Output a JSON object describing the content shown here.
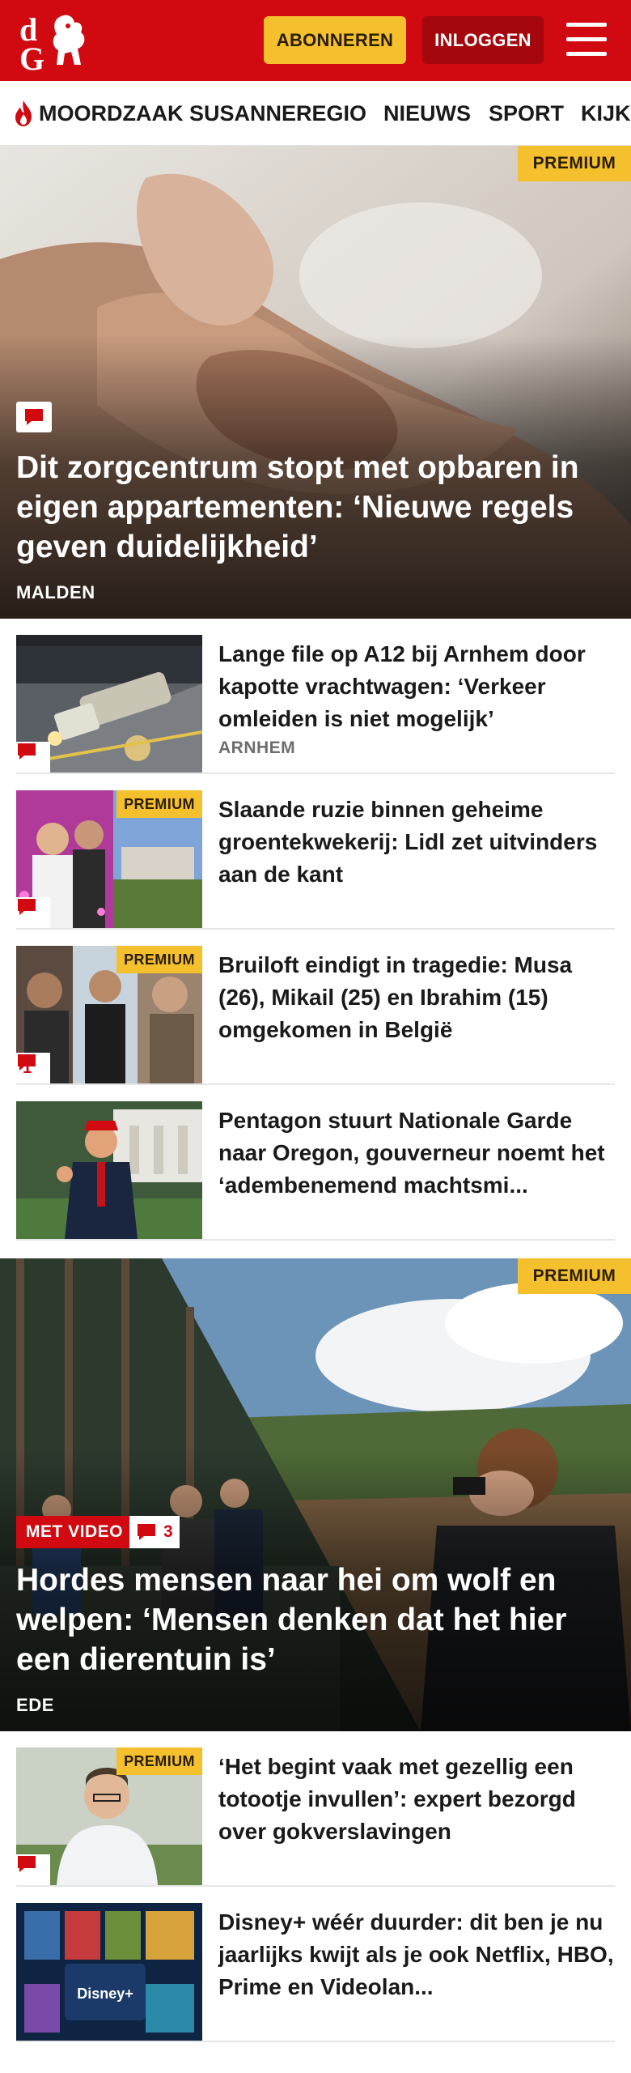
{
  "header": {
    "logo_text": "dG",
    "subscribe_label": "ABONNEREN",
    "login_label": "INLOGGEN",
    "colors": {
      "brand_red": "#d10a11",
      "premium_yellow": "#f5c02e"
    }
  },
  "nav": {
    "items": [
      {
        "label": "MOORDZAAK SUSANNE",
        "icon": "flame-icon"
      },
      {
        "label": "REGIO"
      },
      {
        "label": "NIEUWS"
      },
      {
        "label": "SPORT"
      },
      {
        "label": "KIJK"
      }
    ]
  },
  "hero1": {
    "premium": "PREMIUM",
    "title": "Dit zorgcentrum stopt met opbaren in eigen appartementen: ‘Nieuwe regels geven duidelijkheid’",
    "location": "MALDEN",
    "icon": "comment-icon"
  },
  "articles1": [
    {
      "title": "Lange file op A12 bij Arnhem door kapotte vrachtwagen: ‘Verkeer omleiden is niet mogelijk’",
      "location": "ARNHEM",
      "premium": "",
      "comments": ""
    },
    {
      "title": "Slaande ruzie binnen geheime groentekwekerij: Lidl zet uitvinders aan de kant",
      "location": "",
      "premium": "PREMIUM",
      "comments": ""
    },
    {
      "title": "Bruiloft eindigt in tragedie: Musa (26), Mikail (25) en Ibrahim (15) omgekomen in België",
      "location": "",
      "premium": "PREMIUM",
      "comments": "1"
    },
    {
      "title": "Pentagon stuurt Nationale Garde naar Oregon, gouverneur noemt het ‘adembenemend machtsmi...",
      "location": "",
      "premium": "",
      "comments": ""
    }
  ],
  "hero2": {
    "premium": "PREMIUM",
    "video_label": "MET VIDEO",
    "comments": "3",
    "title": "Hordes mensen naar hei om wolf en welpen: ‘Mensen denken dat het hier een dierentuin is’",
    "location": "EDE"
  },
  "articles2": [
    {
      "title": "‘Het begint vaak met gezellig een totootje invullen’: expert bezorgd over gokverslavingen",
      "premium": "PREMIUM"
    },
    {
      "title": "Disney+ wéér duurder: dit ben je nu jaarlijks kwijt als je ook Netflix, HBO, Prime en Videolan...",
      "premium": ""
    }
  ]
}
